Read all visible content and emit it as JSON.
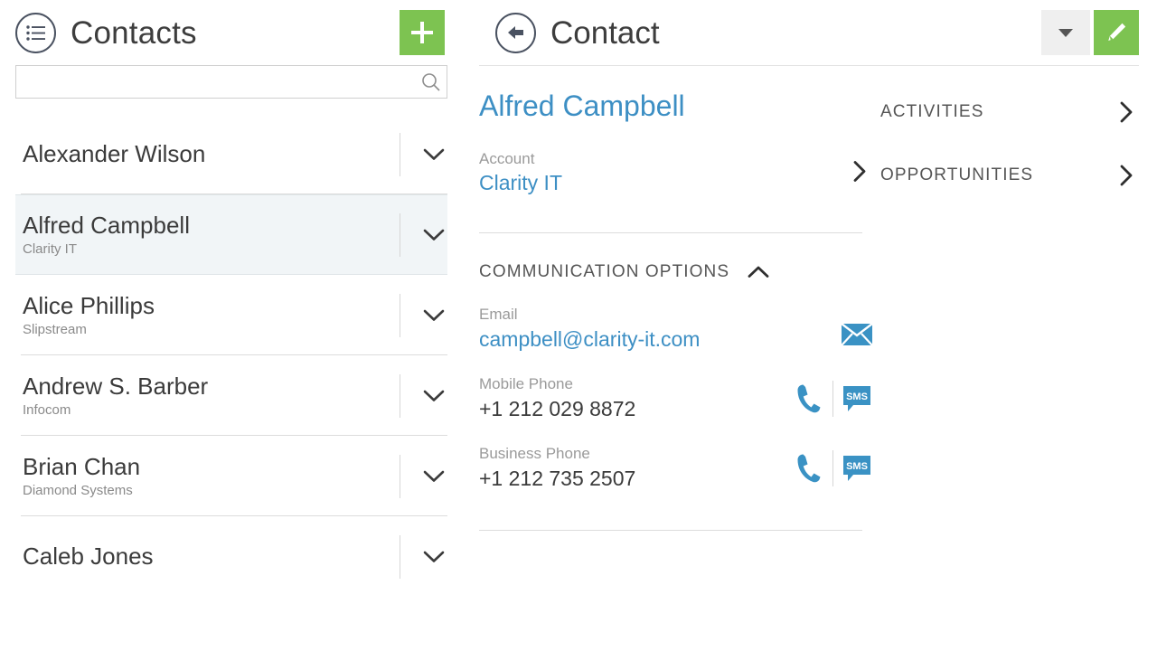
{
  "left": {
    "header": {
      "icon": "list-circle-icon",
      "title": "Contacts",
      "add_label": "+"
    },
    "search": {
      "value": "",
      "placeholder": "",
      "icon": "search-icon"
    },
    "contacts": [
      {
        "name": "Alexander Wilson",
        "company": "",
        "selected": false
      },
      {
        "name": "Alfred Campbell",
        "company": "Clarity IT",
        "selected": true
      },
      {
        "name": "Alice Phillips",
        "company": "Slipstream",
        "selected": false
      },
      {
        "name": "Andrew S. Barber",
        "company": "Infocom",
        "selected": false
      },
      {
        "name": "Brian Chan",
        "company": "Diamond Systems",
        "selected": false
      },
      {
        "name": "Caleb Jones",
        "company": "",
        "selected": false
      }
    ]
  },
  "right": {
    "header": {
      "back_icon": "back-arrow-circle-icon",
      "title": "Contact",
      "dropdown_icon": "chevron-down-icon",
      "edit_icon": "pencil-icon"
    },
    "person_name": "Alfred Campbell",
    "account": {
      "label": "Account",
      "value": "Clarity IT",
      "chevron_icon": "chevron-right-icon"
    },
    "communication": {
      "section_title": "COMMUNICATION OPTIONS",
      "collapse_icon": "chevron-up-icon",
      "rows": [
        {
          "label": "Email",
          "value": "campbell@clarity-it.com",
          "is_link": true,
          "actions": [
            "envelope-icon"
          ]
        },
        {
          "label": "Mobile Phone",
          "value": "+1 212 029 8872",
          "is_link": false,
          "actions": [
            "phone-icon",
            "sms-icon"
          ]
        },
        {
          "label": "Business Phone",
          "value": "+1 212 735 2507",
          "is_link": false,
          "actions": [
            "phone-icon",
            "sms-icon"
          ]
        }
      ]
    },
    "side_links": [
      {
        "label": "ACTIVITIES",
        "chevron_icon": "chevron-right-icon"
      },
      {
        "label": "OPPORTUNITIES",
        "chevron_icon": "chevron-right-icon"
      }
    ]
  },
  "colors": {
    "accent_green": "#7dc351",
    "link_blue": "#3d8fc4",
    "icon_blue": "#3a92c4",
    "selected_row_bg": "#f1f5f7",
    "text_dark": "#3b3b3b",
    "text_muted": "#9a9a9a"
  }
}
